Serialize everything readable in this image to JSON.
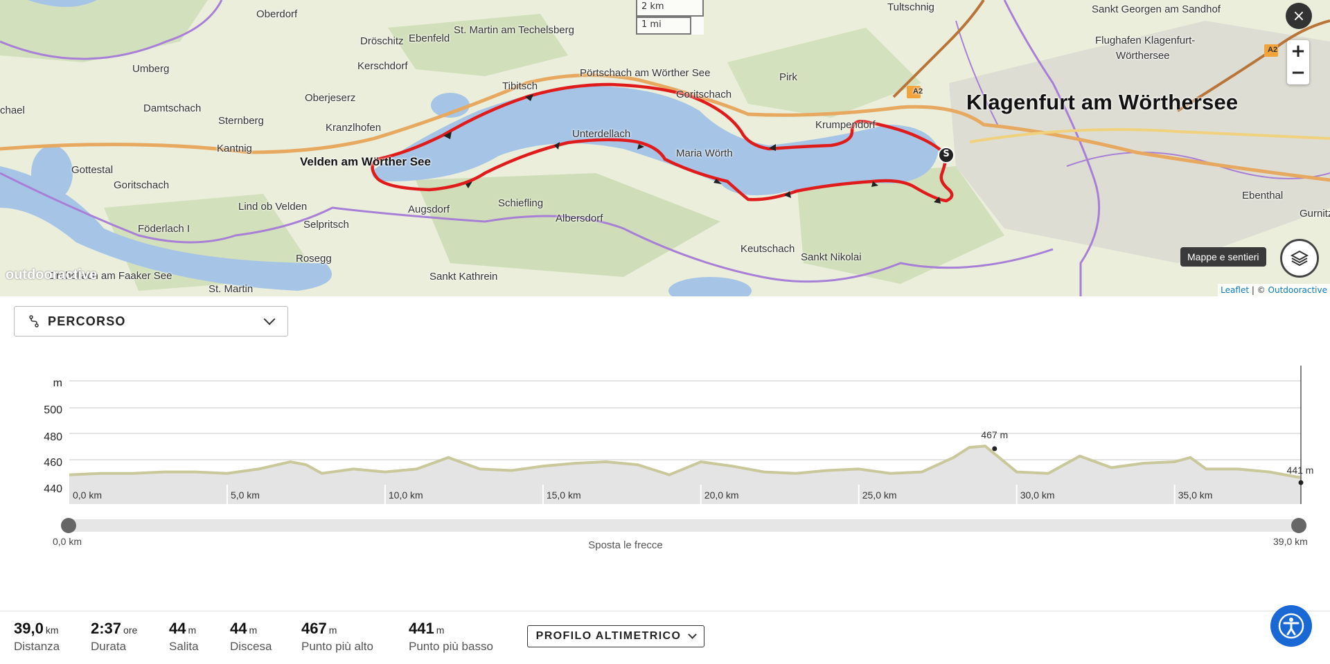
{
  "map": {
    "places": [
      {
        "name": "Oberdorf"
      },
      {
        "name": "Dröschitz"
      },
      {
        "name": "Ebenfeld"
      },
      {
        "name": "St. Martin am Techelsberg"
      },
      {
        "name": "Tultschnig"
      },
      {
        "name": "Sankt Georgen am Sandhof"
      },
      {
        "name": "Flughafen Klagenfurt-"
      },
      {
        "name": "Wörthersee"
      },
      {
        "name": "Umberg"
      },
      {
        "name": "Kerschdorf"
      },
      {
        "name": "Tibitsch"
      },
      {
        "name": "Pörtschach am Wörther See"
      },
      {
        "name": "Pirk"
      },
      {
        "name": "chael"
      },
      {
        "name": "Damtschach"
      },
      {
        "name": "Oberjeserz"
      },
      {
        "name": "Goritschach"
      },
      {
        "name": "Sternberg"
      },
      {
        "name": "Kranzlhofen"
      },
      {
        "name": "Unterdellach"
      },
      {
        "name": "Krumpendorf"
      },
      {
        "name": "Kantnig"
      },
      {
        "name": "Maria Wörth"
      },
      {
        "name": "Gottestal"
      },
      {
        "name": "Goritschach"
      },
      {
        "name": "Lind ob Velden"
      },
      {
        "name": "Augsdorf"
      },
      {
        "name": "Schiefling"
      },
      {
        "name": "Ebenthal"
      },
      {
        "name": "Gurnitz"
      },
      {
        "name": "Föderlach I"
      },
      {
        "name": "Selpritsch"
      },
      {
        "name": "Albersdorf"
      },
      {
        "name": "Keutschach"
      },
      {
        "name": "Sankt Nikolai"
      },
      {
        "name": "Rosegg"
      },
      {
        "name": "Sankt Kathrein"
      },
      {
        "name": "St. Martin"
      },
      {
        "name": "Drobollach am Faaker See"
      }
    ],
    "town_bold": "Velden am Wörther See",
    "city": "Klagenfurt am Wörthersee",
    "road_badges": [
      "A2",
      "A2"
    ],
    "scale": {
      "km": "2 km",
      "mi": "1 mi"
    },
    "zoom_in": "+",
    "zoom_out": "−",
    "close": "×",
    "layers_tooltip": "Mappe e sentieri",
    "start_marker": "S",
    "watermark": "outdooractive",
    "attribution_leaflet": "Leaflet",
    "attribution_sep": " | © ",
    "attribution_source": "Outdooractive",
    "route_color": "#e01b1b",
    "lake_color": "#a6c5e6"
  },
  "panel": {
    "dropdown_label": "PERCORSO",
    "dropdown_icon": "route-icon"
  },
  "chart_data": {
    "type": "area",
    "title": "",
    "ylabel": "m",
    "xlabel": "",
    "ylim": [
      440,
      500
    ],
    "yticks": [
      "500",
      "480",
      "460",
      "440"
    ],
    "xticks": [
      "0,0 km",
      "5,0 km",
      "10,0 km",
      "15,0 km",
      "20,0 km",
      "25,0 km",
      "30,0 km",
      "35,0 km"
    ],
    "xlim": [
      0,
      39
    ],
    "x": [
      0,
      1,
      2,
      3,
      4,
      5,
      6,
      7,
      7.5,
      8,
      9,
      10,
      11,
      12,
      12.5,
      13,
      14,
      15,
      16,
      17,
      18,
      19,
      20,
      21,
      22,
      23,
      24,
      25,
      26,
      27,
      28,
      28.5,
      29,
      30,
      31,
      32,
      33,
      34,
      35,
      35.5,
      36,
      37,
      38,
      39
    ],
    "y": [
      443,
      444,
      444,
      445,
      445,
      444,
      447,
      452,
      450,
      444,
      447,
      445,
      447,
      455,
      451,
      447,
      446,
      449,
      451,
      452,
      450,
      443,
      452,
      449,
      445,
      444,
      446,
      447,
      444,
      445,
      455,
      462,
      463,
      445,
      444,
      456,
      448,
      451,
      452,
      455,
      447,
      447,
      445,
      441
    ],
    "annotations": [
      {
        "x": 29.3,
        "y": 467,
        "label": "467 m"
      },
      {
        "x": 39,
        "y": 441,
        "label": "441 m"
      }
    ],
    "fill": "#e4e4e4",
    "line_color": "#c9c89b",
    "grid": true
  },
  "slider": {
    "min_label": "0,0 km",
    "max_label": "39,0 km",
    "hint": "Sposta le frecce"
  },
  "stats": [
    {
      "value": "39,0",
      "unit": "km",
      "label": "Distanza"
    },
    {
      "value": "2:37",
      "unit": "ore",
      "label": "Durata"
    },
    {
      "value": "44",
      "unit": "m",
      "label": "Salita"
    },
    {
      "value": "44",
      "unit": "m",
      "label": "Discesa"
    },
    {
      "value": "467",
      "unit": "m",
      "label": "Punto più alto"
    },
    {
      "value": "441",
      "unit": "m",
      "label": "Punto più basso"
    }
  ],
  "profile_button": "PROFILO ALTIMETRICO",
  "accessibility_icon": "accessibility-icon"
}
